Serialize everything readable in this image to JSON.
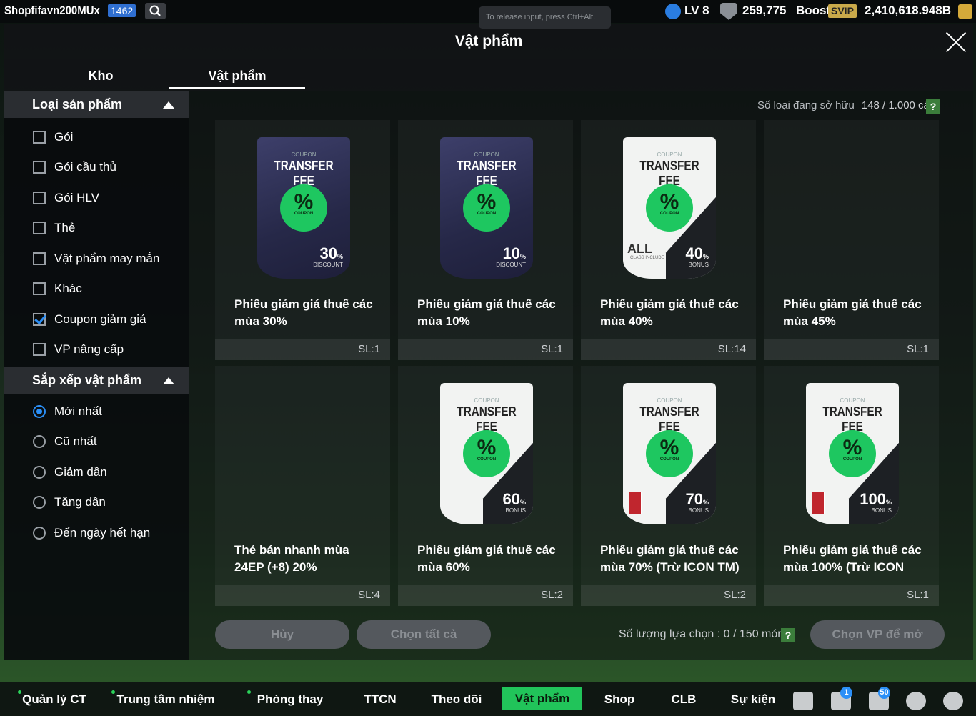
{
  "topbar": {
    "username": "Shopfifavn200MUx",
    "level_badge": "1462",
    "tooltip": "To release input, press Ctrl+Alt.",
    "lv": "LV 8",
    "coins": "259,775",
    "boost_label": "Boost",
    "svip": "SVIP",
    "bp": "2,410,618.948B"
  },
  "panel": {
    "title": "Vật phẩm",
    "tabs": [
      "Kho",
      "Vật phẩm"
    ],
    "active_tab": "Vật phẩm"
  },
  "filters": {
    "type_header": "Loại sản phẩm",
    "types": [
      {
        "label": "Gói",
        "checked": false
      },
      {
        "label": "Gói cầu thủ",
        "checked": false
      },
      {
        "label": "Gói HLV",
        "checked": false
      },
      {
        "label": "Thẻ",
        "checked": false
      },
      {
        "label": "Vật phẩm may mắn",
        "checked": false
      },
      {
        "label": "Khác",
        "checked": false
      },
      {
        "label": "Coupon giảm giá",
        "checked": true
      },
      {
        "label": "VP nâng cấp",
        "checked": false
      }
    ],
    "sort_header": "Sắp xếp vật phẩm",
    "sorts": [
      {
        "label": "Mới nhất",
        "selected": true
      },
      {
        "label": "Cũ nhất",
        "selected": false
      },
      {
        "label": "Giảm dần",
        "selected": false
      },
      {
        "label": "Tăng dần",
        "selected": false
      },
      {
        "label": "Đến ngày hết hạn",
        "selected": false
      }
    ]
  },
  "owned": {
    "label": "Số loại đang sở hữu",
    "value": "148 / 1.000 cái",
    "help": "?"
  },
  "coupon_text": {
    "coupon": "COUPON",
    "transfer_fee": "TRANSFER FEE",
    "discount": "DISCOUNT",
    "bonus": "BONUS",
    "all": "ALL",
    "class_include": "CLASS INCLUDE",
    "percent_sign": "%"
  },
  "items": [
    {
      "name": "Phiếu giảm giá thuế các mùa 30%",
      "qty": "SL:1",
      "style": "dark",
      "pct": "30",
      "sub": "DISCOUNT"
    },
    {
      "name": "Phiếu giảm giá thuế các mùa 10%",
      "qty": "SL:1",
      "style": "dark",
      "pct": "10",
      "sub": "DISCOUNT"
    },
    {
      "name": "Phiếu giảm giá thuế các mùa 40%",
      "qty": "SL:14",
      "style": "light-all",
      "pct": "40",
      "sub": "BONUS"
    },
    {
      "name": "Phiếu giảm giá thuế các mùa 45%",
      "qty": "SL:1",
      "style": "none",
      "pct": "",
      "sub": ""
    },
    {
      "name": "Thẻ bán nhanh mùa 24EP (+8) 20%",
      "qty": "SL:4",
      "style": "none",
      "pct": "",
      "sub": ""
    },
    {
      "name": "Phiếu giảm giá thuế các mùa 60%",
      "qty": "SL:2",
      "style": "light",
      "pct": "60",
      "sub": "BONUS"
    },
    {
      "name": "Phiếu giảm giá thuế các mùa 70% (Trừ ICON TM)",
      "qty": "SL:2",
      "style": "light-restr",
      "pct": "70",
      "sub": "BONUS"
    },
    {
      "name": "Phiếu giảm giá thuế các mùa 100% (Trừ ICON",
      "qty": "SL:1",
      "style": "light-restr",
      "pct": "100",
      "sub": "BONUS"
    }
  ],
  "actions": {
    "cancel": "Hủy",
    "select_all": "Chọn tất cả",
    "selection_count": "Số lượng lựa chọn : 0 / 150 món",
    "help": "?",
    "open": "Chọn VP để mở"
  },
  "bottom_nav": [
    {
      "label": "Quản lý CT",
      "dot": true,
      "active": false
    },
    {
      "label": "Trung tâm nhiệm vụ",
      "dot": true,
      "active": false
    },
    {
      "label": "Phòng thay đồ",
      "dot": true,
      "active": false
    },
    {
      "label": "TTCN",
      "dot": false,
      "active": false
    },
    {
      "label": "Theo dõi",
      "dot": false,
      "active": false
    },
    {
      "label": "Vật phẩm",
      "dot": false,
      "active": true
    },
    {
      "label": "Shop",
      "dot": false,
      "active": false
    },
    {
      "label": "CLB",
      "dot": false,
      "active": false
    },
    {
      "label": "Sự kiện",
      "dot": false,
      "active": false
    }
  ],
  "bottom_icons": [
    {
      "icon": "chat-icon",
      "badge": ""
    },
    {
      "icon": "home-icon",
      "badge": "1"
    },
    {
      "icon": "bell-icon",
      "badge": "50"
    },
    {
      "icon": "profile-icon",
      "badge": ""
    },
    {
      "icon": "settings-icon",
      "badge": ""
    }
  ],
  "colors": {
    "accent": "#21c45a",
    "check": "#2b8ff7"
  }
}
